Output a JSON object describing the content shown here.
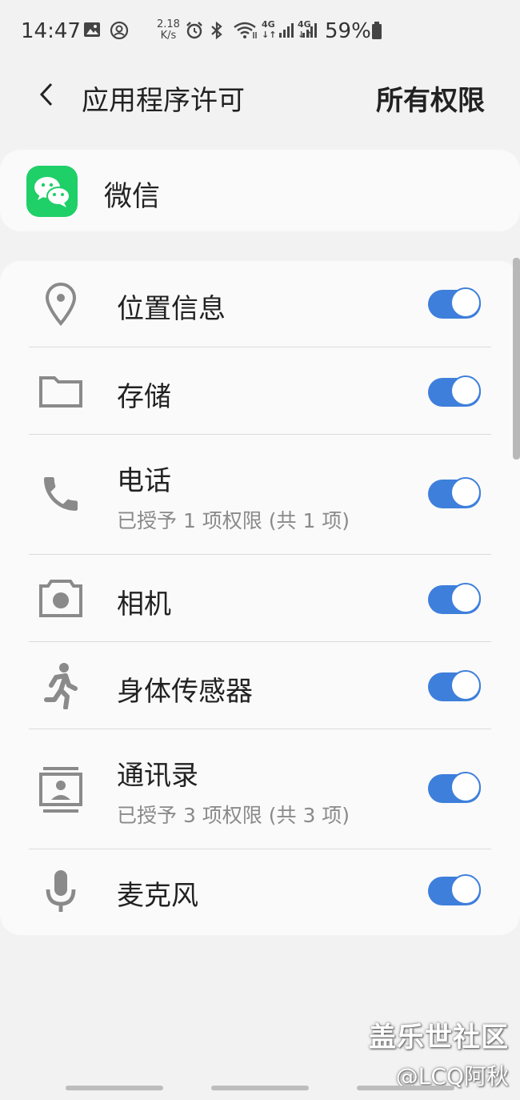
{
  "status_bar": {
    "time": "14:47",
    "net_speed_value": "2.18",
    "net_speed_unit": "K/s",
    "battery_percent": "59%",
    "icons": [
      "gallery-icon",
      "account-circle-icon",
      "alarm-icon",
      "bluetooth-icon",
      "wifi-icon",
      "4g-icon",
      "signal-icon",
      "4g-icon",
      "signal-icon",
      "battery-icon"
    ]
  },
  "header": {
    "title": "应用程序许可",
    "action": "所有权限"
  },
  "app": {
    "name": "微信",
    "icon": "wechat-icon",
    "icon_color": "#1fcf68"
  },
  "permissions": [
    {
      "label": "位置信息",
      "icon": "location-pin-icon",
      "enabled": true
    },
    {
      "label": "存储",
      "icon": "folder-icon",
      "enabled": true
    },
    {
      "label": "电话",
      "sub": "已授予 1 项权限 (共 1 项)",
      "icon": "phone-icon",
      "enabled": true
    },
    {
      "label": "相机",
      "icon": "camera-icon",
      "enabled": true
    },
    {
      "label": "身体传感器",
      "icon": "running-icon",
      "enabled": true
    },
    {
      "label": "通讯录",
      "sub": "已授予 3 项权限 (共 3 项)",
      "icon": "contacts-icon",
      "enabled": true
    },
    {
      "label": "麦克风",
      "icon": "microphone-icon",
      "enabled": true
    }
  ],
  "watermark": {
    "brand": "盖乐世社区",
    "author": "@LCQ阿秋"
  },
  "colors": {
    "toggle_on": "#3e7fdb",
    "background": "#f2f2f2",
    "card": "#fafafa"
  }
}
